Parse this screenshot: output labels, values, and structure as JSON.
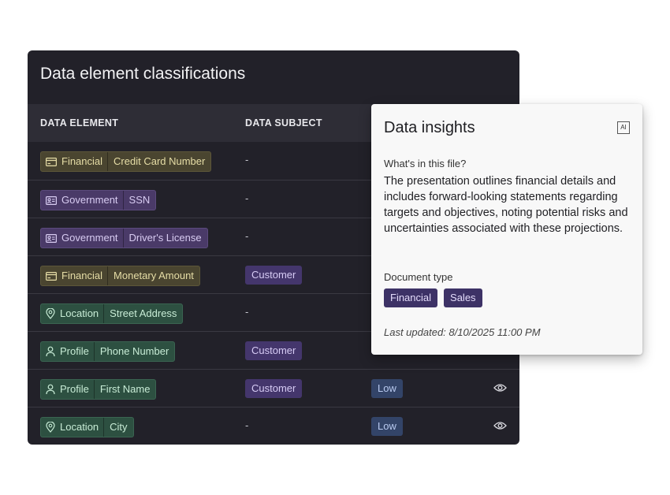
{
  "panel": {
    "title": "Data element classifications",
    "columns": [
      "DATA ELEMENT",
      "DATA SUBJECT"
    ]
  },
  "rows": [
    {
      "category": "Financial",
      "value": "Credit Card Number",
      "icon": "credit-card-icon",
      "subject": "-",
      "sensitivity": ""
    },
    {
      "category": "Government",
      "value": "SSN",
      "icon": "id-card-icon",
      "subject": "-",
      "sensitivity": ""
    },
    {
      "category": "Government",
      "value": "Driver's License",
      "icon": "id-card-icon",
      "subject": "-",
      "sensitivity": ""
    },
    {
      "category": "Financial",
      "value": "Monetary Amount",
      "icon": "credit-card-icon",
      "subject": "Customer",
      "sensitivity": ""
    },
    {
      "category": "Location",
      "value": "Street Address",
      "icon": "location-pin-icon",
      "subject": "-",
      "sensitivity": ""
    },
    {
      "category": "Profile",
      "value": "Phone Number",
      "icon": "person-icon",
      "subject": "Customer",
      "sensitivity": ""
    },
    {
      "category": "Profile",
      "value": "First Name",
      "icon": "person-icon",
      "subject": "Customer",
      "sensitivity": "Low"
    },
    {
      "category": "Location",
      "value": "City",
      "icon": "location-pin-icon",
      "subject": "-",
      "sensitivity": "Low"
    }
  ],
  "insights": {
    "title": "Data insights",
    "ai_badge": "AI",
    "question": "What's in this file?",
    "description": "The presentation outlines financial details and includes forward-looking statements regarding targets and objectives, noting potential risks and uncertainties associated with these projections.",
    "doc_type_label": "Document type",
    "doc_types": [
      "Financial",
      "Sales"
    ],
    "last_updated": "Last updated: 8/10/2025 11:00 PM"
  },
  "colors": {
    "panel_bg": "#222129",
    "header_bg": "#2e2d36",
    "financial": "#4a4530",
    "government": "#4a3a68",
    "location": "#2d5041",
    "subject_badge": "#44366c",
    "low_badge": "#334468",
    "doc_tag": "#3d3266"
  }
}
